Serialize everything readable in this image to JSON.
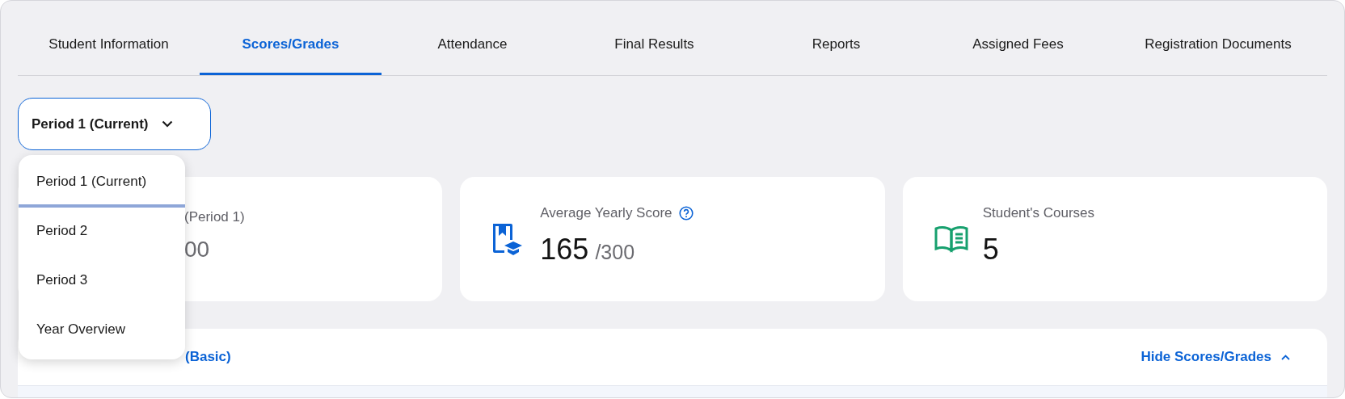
{
  "tabs": [
    {
      "label": "Student Information",
      "selected": false
    },
    {
      "label": "Scores/Grades",
      "selected": true
    },
    {
      "label": "Attendance",
      "selected": false
    },
    {
      "label": "Final Results",
      "selected": false
    },
    {
      "label": "Reports",
      "selected": false
    },
    {
      "label": "Assigned Fees",
      "selected": false
    },
    {
      "label": "Registration Documents",
      "selected": false
    }
  ],
  "period_select": {
    "value": "Period 1 (Current)",
    "expanded": true,
    "options": [
      {
        "label": "Period 1 (Current)",
        "selected": true
      },
      {
        "label": "Period 2",
        "selected": false
      },
      {
        "label": "Period 3",
        "selected": false
      },
      {
        "label": "Year Overview",
        "selected": false
      }
    ]
  },
  "stat_cards": [
    {
      "kind": "covered",
      "title": "(Period 1)",
      "value_suffix": "00"
    },
    {
      "kind": "score",
      "title": "Average Yearly Score",
      "help": true,
      "value": "165",
      "value_suffix": "/300"
    },
    {
      "kind": "courses",
      "title": "Student's Courses",
      "value": "5"
    }
  ],
  "course_panel": {
    "course": "(Basic)",
    "toggle": "Hide Scores/Grades",
    "expanded": true
  }
}
